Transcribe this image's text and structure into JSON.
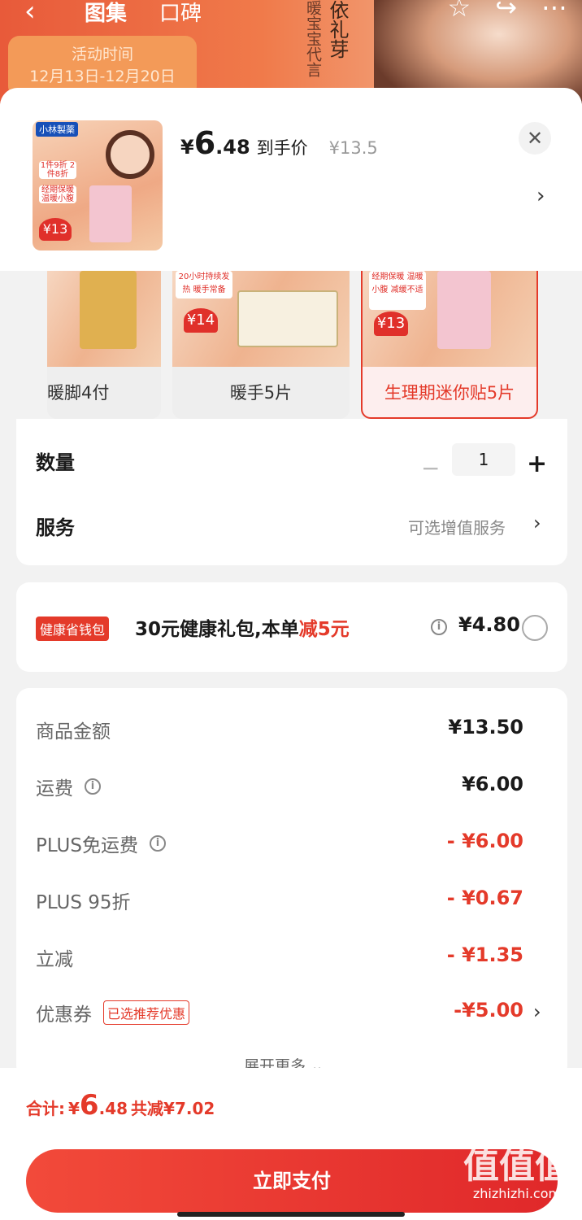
{
  "background": {
    "back_icon": "back-arrow-icon",
    "tabs": [
      "图集",
      "口碑"
    ],
    "activity_title": "活动时间",
    "activity_dates": "12月13日-12月20日",
    "vertical_text_1": "暖宝宝代言",
    "vertical_text_2": "依礼芽",
    "icons": [
      "star-icon",
      "share-icon",
      "more-icon"
    ]
  },
  "product": {
    "thumb_brand": "小林製薬",
    "thumb_pill_1": "1件9折 2件8折",
    "thumb_pill_2": "经期保暖 温暖小腹",
    "thumb_price": "¥13",
    "currency": "¥",
    "price_int": "6",
    "price_dec": ".48",
    "price_tag": "到手价",
    "original_price": "¥13.5"
  },
  "variants": [
    {
      "label": "暖脚4付",
      "selected": false
    },
    {
      "label": "暖手5片",
      "selected": false,
      "badge": "20小时持续发热 暖手常备",
      "price": "¥14"
    },
    {
      "label": "生理期迷你贴5片",
      "selected": true,
      "badge": "经期保暖 温暖小腹 减缓不适",
      "price": "¥13"
    }
  ],
  "options": {
    "quantity_label": "数量",
    "quantity_value": "1",
    "minus": "−",
    "plus": "+",
    "service_label": "服务",
    "service_hint": "可选增值服务"
  },
  "promo": {
    "badge": "健康省钱包",
    "text_prefix": "30元健康礼包,本单",
    "text_highlight": "减5元",
    "price": "¥4.80"
  },
  "summary": {
    "rows": [
      {
        "label": "商品金额",
        "value": "¥13.50",
        "info": false
      },
      {
        "label": "运费",
        "value": "¥6.00",
        "info": true
      },
      {
        "label": "PLUS免运费",
        "value": "- ¥6.00",
        "info": true
      },
      {
        "label": "PLUS 95折",
        "value": "- ¥0.67",
        "info": false
      },
      {
        "label": "立减",
        "value": "- ¥1.35",
        "info": false
      }
    ],
    "coupon_label": "优惠券",
    "coupon_tag": "已选推荐优惠",
    "coupon_value": "-¥5.00",
    "expand": "展开更多"
  },
  "footer": {
    "total_label": "合计:",
    "currency": "¥",
    "total_int": "6",
    "total_dec": ".48",
    "saved": "共减¥7.02",
    "pay_button": "立即支付"
  },
  "watermark": {
    "main": "值值值",
    "sub": "zhizhizhi.com"
  },
  "colors": {
    "accent": "#e43a2a",
    "header": "#e85a3a"
  }
}
